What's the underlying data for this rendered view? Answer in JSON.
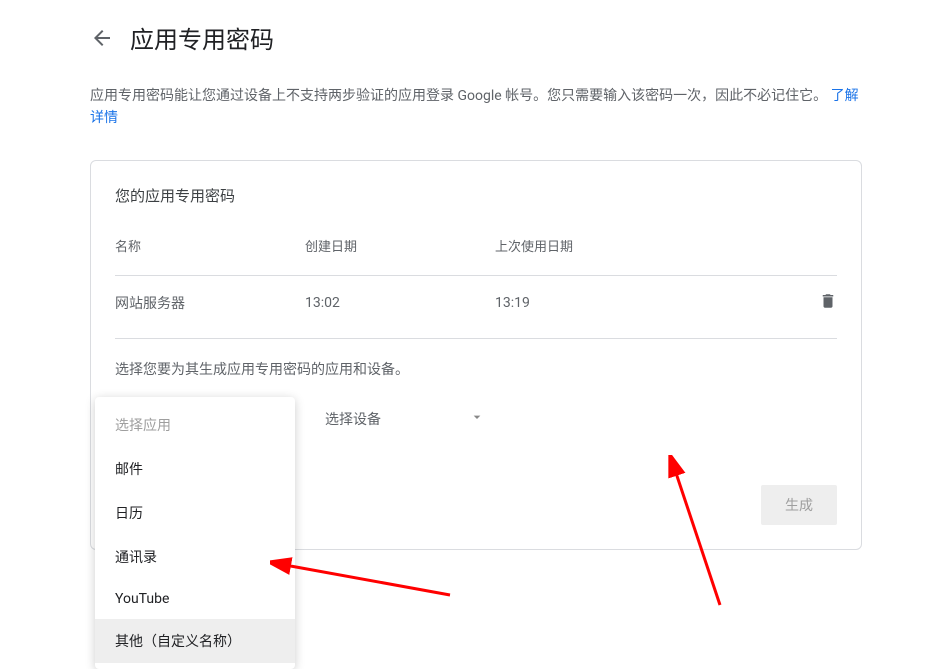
{
  "header": {
    "title": "应用专用密码"
  },
  "description": {
    "text": "应用专用密码能让您通过设备上不支持两步验证的应用登录 Google 帐号。您只需要输入该密码一次，因此不必记住它。",
    "learn_more": "了解详情"
  },
  "card": {
    "title": "您的应用专用密码",
    "columns": {
      "name": "名称",
      "created": "创建日期",
      "last_used": "上次使用日期"
    },
    "row": {
      "name": "网站服务器",
      "created": "13:02",
      "last_used": "13:19"
    },
    "select_instruction": "选择您要为其生成应用专用密码的应用和设备。",
    "app_select": {
      "placeholder": "选择应用",
      "options": [
        "邮件",
        "日历",
        "通讯录",
        "YouTube",
        "其他（自定义名称）"
      ]
    },
    "device_select": {
      "placeholder": "选择设备"
    },
    "generate_label": "生成"
  }
}
